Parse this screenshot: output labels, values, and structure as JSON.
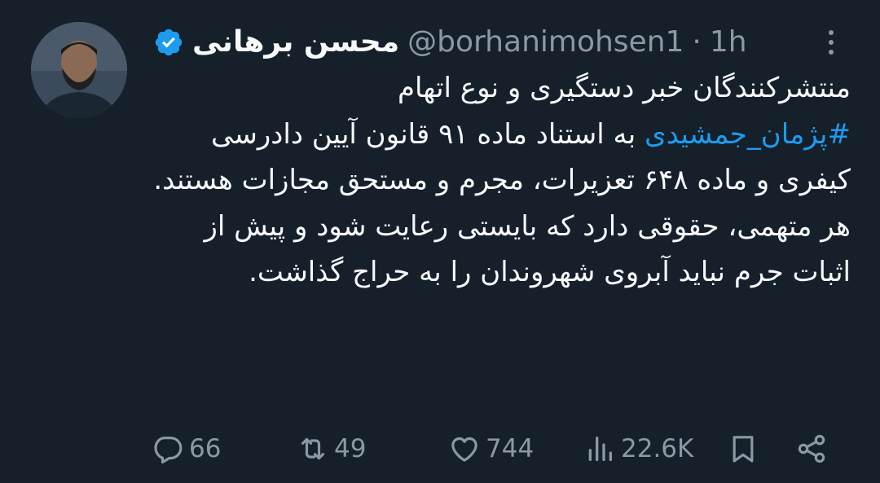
{
  "tweet": {
    "author_name": "محسن برهانی",
    "author_handle": "@borhanimohsen1",
    "separator": "·",
    "timestamp": "1h",
    "body": {
      "line1": "منتشرکنندگان خبر دستگیری و نوع اتهام",
      "hashtag": "#پژمان_جمشیدی",
      "line2_rest": " به استناد ماده ۹۱ قانون آیین دادرسی کیفری و ماده ۶۴۸ تعزیرات، مجرم و مستحق مجازات هستند.",
      "line3": "هر متهمی، حقوقی دارد که بایستی رعایت شود و پیش از اثبات جرم نباید آبروی شهروندان را به حراج گذاشت."
    }
  },
  "actions": {
    "replies": "66",
    "retweets": "49",
    "likes": "744",
    "views": "22.6K"
  },
  "icons": {
    "verified": "verified-badge-icon",
    "more": "more-options-icon",
    "reply": "reply-icon",
    "retweet": "retweet-icon",
    "like": "heart-icon",
    "views": "views-icon",
    "bookmark": "bookmark-icon",
    "share": "share-icon"
  },
  "colors": {
    "background": "#15202b",
    "text_primary": "#f7f9f9",
    "text_secondary": "#8b98a5",
    "accent": "#1d9bf0"
  }
}
